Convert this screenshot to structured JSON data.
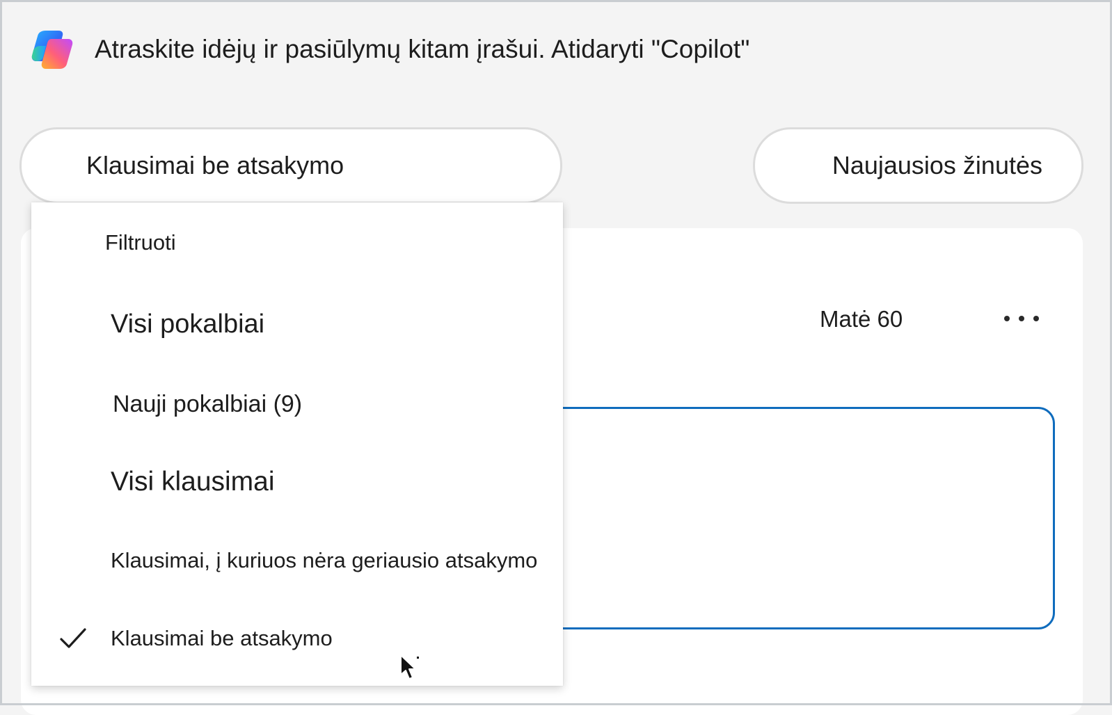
{
  "banner": {
    "icon": "copilot-icon",
    "text": "Atraskite idėjų ir pasiūlymų kitam įrašui. Atidaryti \"Copilot\""
  },
  "filter_button": {
    "label": "Klausimai be atsakymo"
  },
  "sort_button": {
    "label": "Naujausios žinutės"
  },
  "post": {
    "seen_text": "Matė 60",
    "more_icon": "more-horizontal-icon"
  },
  "dropdown": {
    "header": "Filtruoti",
    "items": [
      {
        "label": "Visi pokalbiai",
        "selected": false
      },
      {
        "label": "Nauji pokalbiai (9)",
        "selected": false
      },
      {
        "label": "Visi klausimai",
        "selected": false
      },
      {
        "label": "Klausimai, į kuriuos nėra geriausio atsakymo",
        "selected": false
      },
      {
        "label": "Klausimai be atsakymo",
        "selected": true
      }
    ]
  },
  "colors": {
    "accent": "#0f6cbd",
    "background": "#f4f4f4",
    "surface": "#ffffff",
    "border": "#dcdcdc"
  }
}
